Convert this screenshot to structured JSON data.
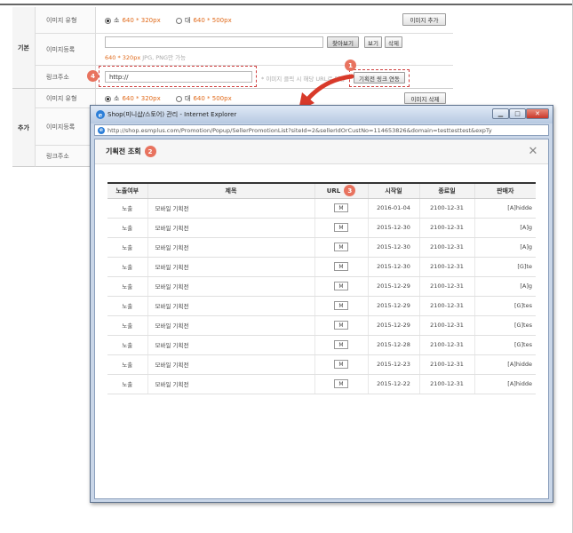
{
  "form": {
    "sections": {
      "basic": "기본",
      "extra": "추가"
    },
    "labels": {
      "image_type": "이미지 유형",
      "image_register": "이미지등록",
      "link_address": "링크주소"
    },
    "image_type": {
      "small_prefix": "소",
      "small_size": "640 * 320px",
      "large_prefix": "대",
      "large_size": "640 * 500px"
    },
    "buttons": {
      "add_image": "이미지 추가",
      "find_file": "찾아보기",
      "view": "보기",
      "delete": "삭제",
      "promo_link": "기획전 링크 연동",
      "delete_image": "이미지 삭제"
    },
    "size_note_size": "640 * 320px",
    "size_note_text": "JPG, PNG만 가능",
    "link_value": "http://",
    "link_hint": "* 이미지 클릭 시 해당 URL로 이동",
    "badges": {
      "b1": "1",
      "b2": "2",
      "b3": "3",
      "b4": "4"
    }
  },
  "popup": {
    "window_title": "Shop(미니샵/스토어) 관리 - Internet Explorer",
    "address": "http://shop.esmplus.com/Promotion/Popup/SellerPromotionList?siteId=2&sellerIdOrCustNo=114653826&domain=testtesttest&expTy",
    "header_title": "기획전 조회",
    "columns": [
      "노출여부",
      "제목",
      "URL",
      "시작일",
      "종료일",
      "판매자"
    ],
    "url_button": "M",
    "rows": [
      {
        "status": "노출",
        "title": "모바일 기획전",
        "start": "2016-01-04",
        "end": "2100-12-31",
        "seller": "[A]hidde"
      },
      {
        "status": "노출",
        "title": "모바일 기획전",
        "start": "2015-12-30",
        "end": "2100-12-31",
        "seller": "[A]g"
      },
      {
        "status": "노출",
        "title": "모바일 기획전",
        "start": "2015-12-30",
        "end": "2100-12-31",
        "seller": "[A]g"
      },
      {
        "status": "노출",
        "title": "모바일 기획전",
        "start": "2015-12-30",
        "end": "2100-12-31",
        "seller": "[G]te"
      },
      {
        "status": "노출",
        "title": "모바일 기획전",
        "start": "2015-12-29",
        "end": "2100-12-31",
        "seller": "[A]g"
      },
      {
        "status": "노출",
        "title": "모바일 기획전",
        "start": "2015-12-29",
        "end": "2100-12-31",
        "seller": "[G]tes"
      },
      {
        "status": "노출",
        "title": "모바일 기획전",
        "start": "2015-12-29",
        "end": "2100-12-31",
        "seller": "[G]tes"
      },
      {
        "status": "노출",
        "title": "모바일 기획전",
        "start": "2015-12-28",
        "end": "2100-12-31",
        "seller": "[G]tes"
      },
      {
        "status": "노출",
        "title": "모바일 기획전",
        "start": "2015-12-23",
        "end": "2100-12-31",
        "seller": "[A]hidde"
      },
      {
        "status": "노출",
        "title": "모바일 기획전",
        "start": "2015-12-22",
        "end": "2100-12-31",
        "seller": "[A]hidde"
      }
    ]
  }
}
